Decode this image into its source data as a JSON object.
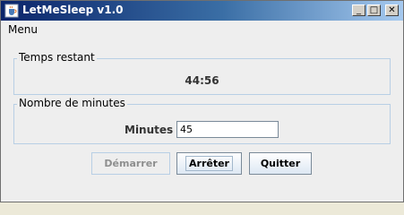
{
  "window": {
    "title": "LetMeSleep v1.0",
    "icon": "java-cup-icon",
    "controls": [
      "minimize-icon",
      "maximize-icon",
      "close-icon"
    ]
  },
  "menubar": {
    "items": [
      {
        "label": "Menu"
      }
    ]
  },
  "remaining": {
    "legend": "Temps restant",
    "value": "44:56"
  },
  "minutes": {
    "legend": "Nombre de minutes",
    "label": "Minutes :",
    "value": "45"
  },
  "buttons": {
    "start": "Démarrer",
    "stop": "Arrêter",
    "quit": "Quitter"
  },
  "colors": {
    "titlebar_start": "#0A246A",
    "titlebar_end": "#A6CAF0",
    "panel_border": "#B8CFE5",
    "background": "#EEEEEE"
  }
}
